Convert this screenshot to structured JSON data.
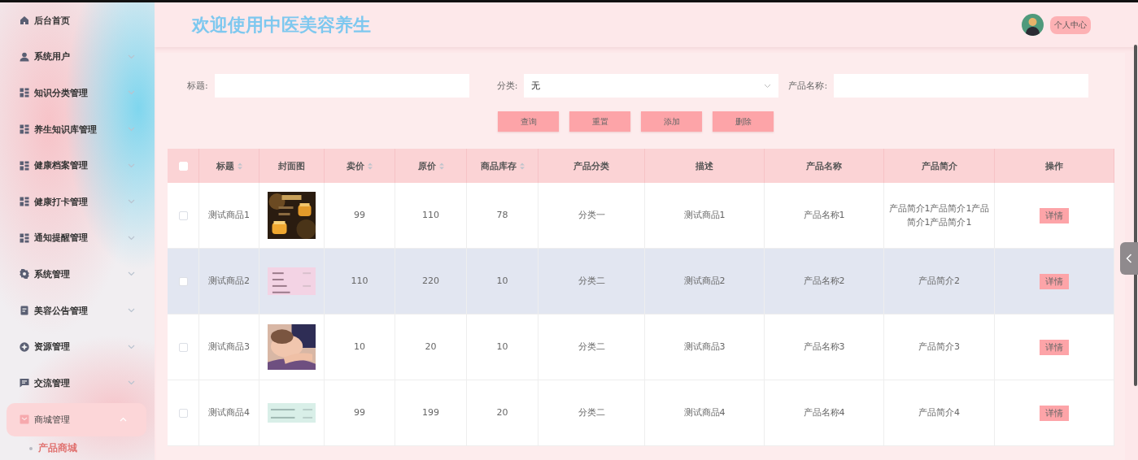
{
  "sidebar": {
    "items": [
      {
        "label": "后台首页",
        "kind": "link",
        "selected": false
      },
      {
        "label": "系统用户",
        "kind": "submenu",
        "expanded": false,
        "selected": false
      },
      {
        "label": "知识分类管理",
        "kind": "submenu",
        "expanded": false,
        "selected": false
      },
      {
        "label": "养生知识库管理",
        "kind": "submenu",
        "expanded": false,
        "selected": false
      },
      {
        "label": "健康档案管理",
        "kind": "submenu",
        "expanded": false,
        "selected": false
      },
      {
        "label": "健康打卡管理",
        "kind": "submenu",
        "expanded": false,
        "selected": false
      },
      {
        "label": "通知提醒管理",
        "kind": "submenu",
        "expanded": false,
        "selected": false
      },
      {
        "label": "系统管理",
        "kind": "submenu",
        "expanded": false,
        "selected": false
      },
      {
        "label": "美容公告管理",
        "kind": "submenu",
        "expanded": false,
        "selected": false
      },
      {
        "label": "资源管理",
        "kind": "submenu",
        "expanded": false,
        "selected": false
      },
      {
        "label": "交流管理",
        "kind": "submenu",
        "expanded": false,
        "selected": false
      },
      {
        "label": "商城管理",
        "kind": "submenu",
        "expanded": true,
        "selected": true,
        "children": [
          {
            "label": "产品商城",
            "selected": true
          }
        ]
      }
    ]
  },
  "header": {
    "title": "欢迎使用中医美容养生",
    "user_button": "个人中心"
  },
  "search": {
    "fields": [
      {
        "label": "标题:",
        "kind": "input"
      },
      {
        "label": "分类:",
        "kind": "select",
        "value": "无"
      },
      {
        "label": "产品名称:",
        "kind": "input"
      }
    ],
    "buttons": [
      "查询",
      "重置",
      "添加",
      "删除"
    ]
  },
  "table": {
    "header_checked": false,
    "columns": [
      {
        "label": "标题",
        "sortable": true
      },
      {
        "label": "封面图",
        "sortable": false
      },
      {
        "label": "卖价",
        "sortable": true
      },
      {
        "label": "原价",
        "sortable": true
      },
      {
        "label": "商品库存",
        "sortable": true
      },
      {
        "label": "产品分类",
        "sortable": false
      },
      {
        "label": "描述",
        "sortable": false
      },
      {
        "label": "产品名称",
        "sortable": false
      },
      {
        "label": "产品简介",
        "sortable": false
      },
      {
        "label": "操作",
        "sortable": false
      }
    ],
    "rows": [
      {
        "checked": false,
        "highlighted": false,
        "title": "测试商品1",
        "price": "99",
        "original_price": "110",
        "stock": "78",
        "category": "分类一",
        "description": "测试商品1",
        "name": "产品名称1",
        "intro": "产品简介1产品简介1产品简介1产品简介1",
        "action": "详情"
      },
      {
        "checked": false,
        "highlighted": true,
        "title": "测试商品2",
        "price": "110",
        "original_price": "220",
        "stock": "10",
        "category": "分类二",
        "description": "测试商品2",
        "name": "产品名称2",
        "intro": "产品简介2",
        "action": "详情"
      },
      {
        "checked": false,
        "highlighted": false,
        "title": "测试商品3",
        "price": "10",
        "original_price": "20",
        "stock": "10",
        "category": "分类二",
        "description": "测试商品3",
        "name": "产品名称3",
        "intro": "产品简介3",
        "action": "详情"
      },
      {
        "checked": false,
        "highlighted": false,
        "title": "测试商品4",
        "price": "99",
        "original_price": "199",
        "stock": "20",
        "category": "分类二",
        "description": "测试商品4",
        "name": "产品名称4",
        "intro": "产品简介4",
        "action": "详情"
      }
    ]
  }
}
